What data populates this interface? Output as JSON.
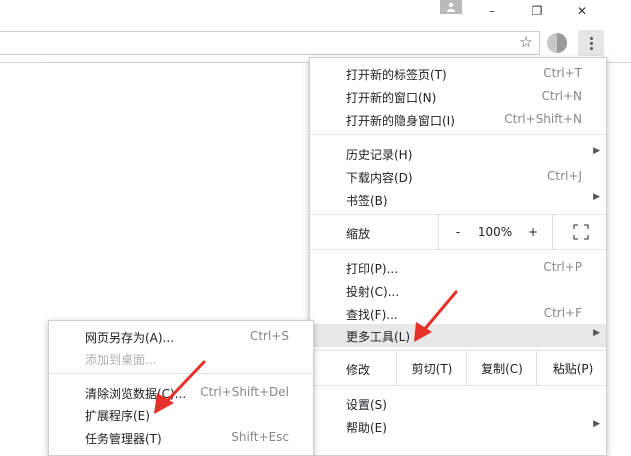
{
  "window": {
    "minimize_glyph": "–",
    "restore_glyph": "❐",
    "close_glyph": "✕"
  },
  "toolbar": {
    "star_glyph": "☆"
  },
  "menu": {
    "new_tab": {
      "label": "打开新的标签页(T)",
      "shortcut": "Ctrl+T"
    },
    "new_window": {
      "label": "打开新的窗口(N)",
      "shortcut": "Ctrl+N"
    },
    "incognito": {
      "label": "打开新的隐身窗口(I)",
      "shortcut": "Ctrl+Shift+N"
    },
    "history": {
      "label": "历史记录(H)"
    },
    "downloads": {
      "label": "下载内容(D)",
      "shortcut": "Ctrl+J"
    },
    "bookmarks": {
      "label": "书签(B)"
    },
    "zoom": {
      "label": "缩放",
      "minus": "-",
      "value": "100%",
      "plus": "+"
    },
    "print": {
      "label": "打印(P)...",
      "shortcut": "Ctrl+P"
    },
    "cast": {
      "label": "投射(C)..."
    },
    "find": {
      "label": "查找(F)...",
      "shortcut": "Ctrl+F"
    },
    "more_tools": {
      "label": "更多工具(L)"
    },
    "edit": {
      "label": "修改",
      "cut": "剪切(T)",
      "copy": "复制(C)",
      "paste": "粘贴(P)"
    },
    "settings": {
      "label": "设置(S)"
    },
    "help": {
      "label": "帮助(E)"
    }
  },
  "submenu": {
    "save_page": {
      "label": "网页另存为(A)...",
      "shortcut": "Ctrl+S"
    },
    "add_desktop": {
      "label": "添加到桌面..."
    },
    "clear_data": {
      "label": "清除浏览数据(C)...",
      "shortcut": "Ctrl+Shift+Del"
    },
    "extensions": {
      "label": "扩展程序(E)"
    },
    "task_manager": {
      "label": "任务管理器(T)",
      "shortcut": "Shift+Esc"
    }
  },
  "colors": {
    "annotation_arrow": "#e8302a"
  }
}
